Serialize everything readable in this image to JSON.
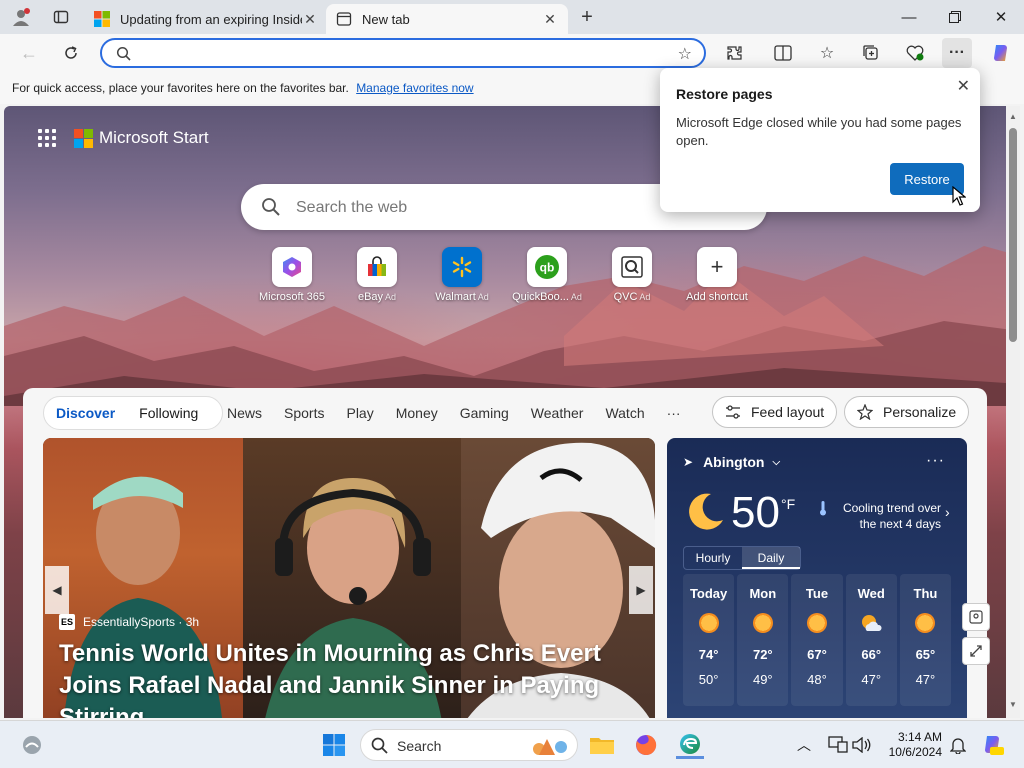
{
  "browser": {
    "tabs": [
      {
        "title": "Updating from an expiring Inside",
        "active": false
      },
      {
        "title": "New tab",
        "active": true
      }
    ],
    "address_bar": {
      "value": "",
      "placeholder": ""
    },
    "favorites_bar": {
      "text": "For quick access, place your favorites here on the favorites bar.",
      "link": "Manage favorites now"
    }
  },
  "start_page": {
    "brand": "Microsoft Start",
    "search_placeholder": "Search the web",
    "shortcuts": [
      {
        "label": "Microsoft 365",
        "ad": ""
      },
      {
        "label": "eBay",
        "ad": "Ad"
      },
      {
        "label": "Walmart",
        "ad": "Ad"
      },
      {
        "label": "QuickBoo...",
        "ad": "Ad"
      },
      {
        "label": "QVC",
        "ad": "Ad"
      },
      {
        "label": "Add shortcut",
        "ad": ""
      }
    ],
    "feed_nav": {
      "pill": [
        "Discover",
        "Following"
      ],
      "links": [
        "News",
        "Sports",
        "Play",
        "Money",
        "Gaming",
        "Weather",
        "Watch",
        "···"
      ],
      "feed_layout": "Feed layout",
      "personalize": "Personalize"
    },
    "hero": {
      "source_logo": "ES",
      "source": "EssentiallySports · 3h",
      "headline": "Tennis World Unites in Mourning as Chris Evert Joins Rafael Nadal and Jannik Sinner in Paying Stirring..."
    },
    "weather": {
      "location": "Abington",
      "temp": "50",
      "unit": "°F",
      "trend": "Cooling trend over the next 4 days",
      "tabs": [
        "Hourly",
        "Daily"
      ],
      "days": [
        {
          "day": "Today",
          "high": "74°",
          "low": "50°",
          "icon": "sun-icon"
        },
        {
          "day": "Mon",
          "high": "72°",
          "low": "49°",
          "icon": "sun-icon"
        },
        {
          "day": "Tue",
          "high": "67°",
          "low": "48°",
          "icon": "sun-icon"
        },
        {
          "day": "Wed",
          "high": "66°",
          "low": "47°",
          "icon": "partly-cloudy-icon"
        },
        {
          "day": "Thu",
          "high": "65°",
          "low": "47°",
          "icon": "sun-icon"
        }
      ]
    }
  },
  "popup": {
    "title": "Restore pages",
    "message": "Microsoft Edge closed while you had some pages open.",
    "button": "Restore"
  },
  "taskbar": {
    "search_label": "Search",
    "time": "3:14 AM",
    "date": "10/6/2024"
  },
  "colors": {
    "accent": "#0f6cbd",
    "link": "#0b59c5",
    "address_focus": "#2b6cdf"
  }
}
